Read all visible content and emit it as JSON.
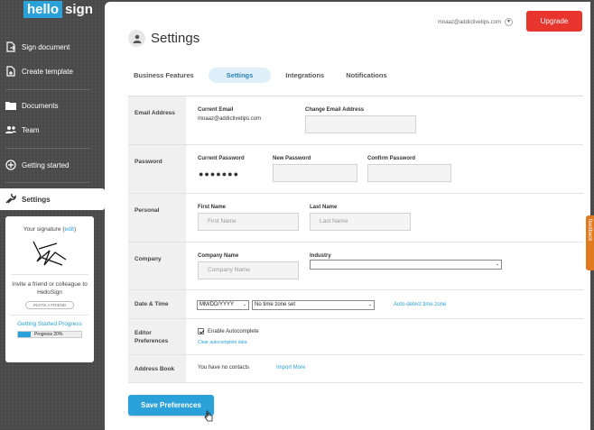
{
  "logo": {
    "hello": "hello",
    "sign": "sign"
  },
  "sidebar": {
    "items": [
      {
        "label": "Sign document",
        "icon": "sign-document-icon"
      },
      {
        "label": "Create template",
        "icon": "create-template-icon"
      },
      {
        "label": "Documents",
        "icon": "folder-icon"
      },
      {
        "label": "Team",
        "icon": "team-icon"
      },
      {
        "label": "Getting started",
        "icon": "plus-circle-icon"
      }
    ],
    "active": {
      "label": "Settings",
      "icon": "wrench-icon"
    }
  },
  "signature_box": {
    "title_prefix": "Your signature (",
    "edit": "edit",
    "title_suffix": ")",
    "invite_text": "Invite a friend or colleague to HelloSign",
    "invite_button": "INVITE A FRIEND",
    "progress_link": "Getting Started Progress",
    "progress_label": "Progress 20%",
    "progress_value": 0.2
  },
  "header": {
    "email": "moaaz@addictivetips.com",
    "upgrade": "Upgrade",
    "page_title": "Settings"
  },
  "tabs": [
    {
      "label": "Business Features",
      "active": false
    },
    {
      "label": "Settings",
      "active": true
    },
    {
      "label": "Integrations",
      "active": false
    },
    {
      "label": "Notifications",
      "active": false
    }
  ],
  "rows": {
    "email": {
      "label": "Email Address",
      "current_label": "Current Email",
      "current_value": "moaaz@addictivetips.com",
      "change_label": "Change Email Address"
    },
    "password": {
      "label": "Password",
      "current_label": "Current Password",
      "current_value": "●●●●●●●",
      "new_label": "New Password",
      "confirm_label": "Confirm Password"
    },
    "personal": {
      "label": "Personal",
      "first_label": "First Name",
      "first_placeholder": "First Name",
      "last_label": "Last Name",
      "last_placeholder": "Last Name"
    },
    "company": {
      "label": "Company",
      "name_label": "Company Name",
      "name_placeholder": "Company Name",
      "industry_label": "Industry",
      "industry_value": ""
    },
    "datetime": {
      "label": "Date & Time",
      "date_format": "MM/DD/YYYY",
      "timezone": "No time zone set",
      "auto_detect": "Auto-detect time zone"
    },
    "editor": {
      "label": "Editor Preferences",
      "autocomplete_label": "Enable Autocomplete",
      "autocomplete_checked": true,
      "clear_link": "Clear autocomplete data"
    },
    "address_book": {
      "label": "Address Book",
      "value": "You have no contacts",
      "import_link": "Import More"
    }
  },
  "save_button": "Save Preferences",
  "feedback": "feedback",
  "colors": {
    "accent": "#2aa1d8",
    "upgrade": "#e8352e",
    "feedback": "#e07a1f"
  }
}
